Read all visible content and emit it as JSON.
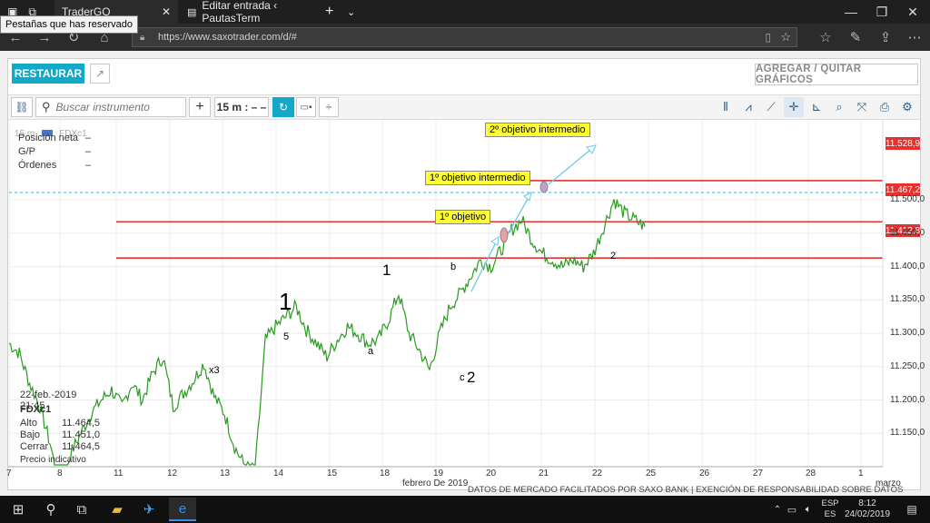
{
  "browser": {
    "tooltip": "Pestañas que has reservado",
    "tabs": [
      {
        "title": "TraderGO"
      },
      {
        "title": "Editar entrada ‹ PautasTerm"
      }
    ],
    "url": "https://www.saxotrader.com/d/#",
    "icons": [
      "back-icon",
      "forward-icon",
      "refresh-icon",
      "home-icon",
      "reading-view-icon",
      "favorite-star-icon",
      "favorites-hub-icon",
      "pen-icon",
      "share-icon",
      "more-icon"
    ]
  },
  "app": {
    "restore_label": "RESTAURAR",
    "add_remove_label": "AGREGAR / QUITAR GRÁFICOS",
    "search_placeholder": "Buscar instrumento",
    "timeframe_label": "15 m : – –",
    "instrument_header": "FDXc1",
    "instrument_header_prefix": "15 m"
  },
  "position_panel": {
    "rows": [
      {
        "label": "Posición neta",
        "value": "–"
      },
      {
        "label": "G/P",
        "value": "–"
      },
      {
        "label": "Órdenes",
        "value": "–"
      }
    ]
  },
  "ohlc_panel": {
    "datetime": "22-feb.-2019 21:45",
    "instrument": "FDXc1",
    "rows": [
      {
        "label": "Alto",
        "value": "11.464,5"
      },
      {
        "label": "Bajo",
        "value": "11.451,0"
      },
      {
        "label": "Cerrar",
        "value": "11.464,5"
      }
    ],
    "footer": "Precio indicativo"
  },
  "annotations": {
    "targets": [
      "2º objetivo intermedio",
      "1º objetivo intermedio",
      "1º objetivo"
    ],
    "price_tags": [
      "11.528,9",
      "11.467,2",
      "11.412,8"
    ],
    "waves": [
      {
        "text": "1",
        "color": "#e02020"
      },
      {
        "text": "x3",
        "color": "#222222"
      },
      {
        "text": "5",
        "color": "#222222"
      },
      {
        "text": "a",
        "color": "#222222"
      },
      {
        "text": "1",
        "color": "#1f3fbf"
      },
      {
        "text": "b",
        "color": "#222222"
      },
      {
        "text": "c",
        "color": "#222222"
      },
      {
        "text": "2",
        "color": "#1f3fbf"
      },
      {
        "text": "2",
        "color": "#222222"
      }
    ]
  },
  "colors": {
    "accent": "#12a8c8",
    "price_line": "#2a9a20",
    "target_line": "#e8312f",
    "arrow": "#6ec7e8",
    "current_price": "#3aaed8"
  },
  "chart_data": {
    "type": "line",
    "title": "",
    "xlabel": "febrero De 2019",
    "ylabel": "",
    "instrument": "FDXc1",
    "y_ticks": [
      "11.500,0",
      "11.450,0",
      "11.400,0",
      "11.350,0",
      "11.300,0",
      "11.250,0",
      "11.200,0",
      "11.150,0"
    ],
    "x_ticks": [
      "7",
      "8",
      "11",
      "12",
      "13",
      "14",
      "15",
      "18",
      "19",
      "20",
      "21",
      "22",
      "25",
      "26",
      "27",
      "28",
      "1",
      "marzo"
    ],
    "ylim": [
      11100,
      11620
    ],
    "horizontal_lines": [
      11528.9,
      11467.2,
      11412.8
    ],
    "current_price": 11464.5,
    "series": [
      {
        "values": [
          11285,
          11270,
          11225,
          11190,
          11135,
          11060,
          11120,
          11150,
          11180,
          11200,
          11215,
          11190,
          11225,
          11200,
          11240,
          11265,
          11190,
          11210,
          11230,
          11255,
          11205,
          11180,
          11130,
          11100,
          11095,
          11290,
          11310,
          11325,
          11340,
          11305,
          11285,
          11265,
          11290,
          11310,
          11300,
          11285,
          11290,
          11320,
          11360,
          11300,
          11275,
          11245,
          11300,
          11340,
          11360,
          11385,
          11410,
          11400,
          11425,
          11455,
          11470,
          11440,
          11420,
          11410,
          11400,
          11410,
          11400,
          11420,
          11460,
          11500,
          11480,
          11470,
          11460
        ]
      }
    ]
  },
  "taskbar": {
    "lang_top": "ESP",
    "lang_bottom": "ES",
    "time": "8:12",
    "date": "24/02/2019",
    "disclaimer": "DATOS DE MERCADO FACILITADOS POR SAXO BANK | EXENCIÓN DE RESPONSABILIDAD SOBRE DATOS"
  }
}
